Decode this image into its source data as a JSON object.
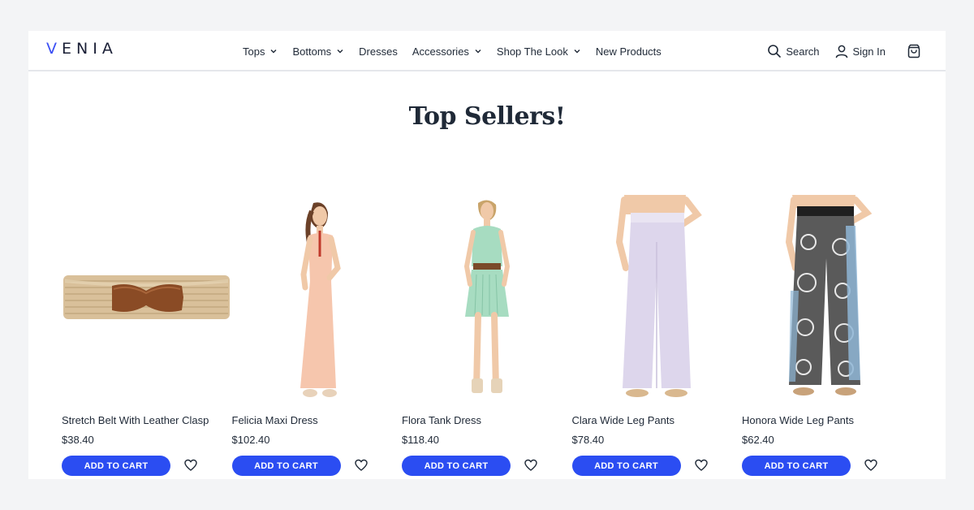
{
  "brand": {
    "letter_v": "V",
    "rest": "ENIA"
  },
  "nav": [
    {
      "label": "Tops",
      "dropdown": true
    },
    {
      "label": "Bottoms",
      "dropdown": true
    },
    {
      "label": "Dresses",
      "dropdown": false
    },
    {
      "label": "Accessories",
      "dropdown": true
    },
    {
      "label": "Shop The Look",
      "dropdown": true
    },
    {
      "label": "New Products",
      "dropdown": false
    }
  ],
  "actions": {
    "search": "Search",
    "signin": "Sign In"
  },
  "section_title": "Top Sellers!",
  "colors": {
    "accent": "#2b4df2",
    "logo_v": "#3b4ff4"
  },
  "products": [
    {
      "name": "Stretch Belt With Leather Clasp",
      "price": "$38.40",
      "cta": "ADD TO CART",
      "image": "woven-belt"
    },
    {
      "name": "Felicia Maxi Dress",
      "price": "$102.40",
      "cta": "ADD TO CART",
      "image": "peach-maxi-dress"
    },
    {
      "name": "Flora Tank Dress",
      "price": "$118.40",
      "cta": "ADD TO CART",
      "image": "mint-tank-dress"
    },
    {
      "name": "Clara Wide Leg Pants",
      "price": "$78.40",
      "cta": "ADD TO CART",
      "image": "lavender-wide-pants"
    },
    {
      "name": "Honora Wide Leg Pants",
      "price": "$62.40",
      "cta": "ADD TO CART",
      "image": "printed-wide-pants"
    }
  ]
}
